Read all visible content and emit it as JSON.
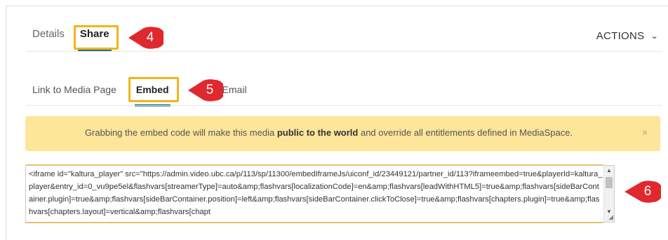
{
  "tabs": {
    "details": "Details",
    "share": "Share",
    "actions": "ACTIONS",
    "actions_chevron": "❯"
  },
  "subtabs": {
    "link": "Link to Media Page",
    "embed": "Embed",
    "email": "Email"
  },
  "alert": {
    "text_before": "Grabbing the embed code will make this media ",
    "text_bold": "public to the world",
    "text_after": " and override all entitlements defined in MediaSpace.",
    "close": "×"
  },
  "embed_code": "<iframe id=\"kaltura_player\" src=\"https://admin.video.ubc.ca/p/113/sp/11300/embedIframeJs/uiconf_id/23449121/partner_id/113?iframeembed=true&playerId=kaltura_player&entry_id=0_vu9pe5el&flashvars[streamerType]=auto&amp;flashvars[localizationCode]=en&amp;flashvars[leadWithHTML5]=true&amp;flashvars[sideBarContainer.plugin]=true&amp;flashvars[sideBarContainer.position]=left&amp;flashvars[sideBarContainer.clickToClose]=true&amp;flashvars[chapters.plugin]=true&amp;flashvars[chapters.layout]=vertical&amp;flashvars[chapt",
  "callouts": {
    "c4": "4",
    "c5": "5",
    "c6": "6"
  },
  "colors": {
    "highlight": "#f3b41b",
    "callout": "#e0282f",
    "tab_underline": "#1a6f8a",
    "alert_bg": "#fde59a"
  }
}
